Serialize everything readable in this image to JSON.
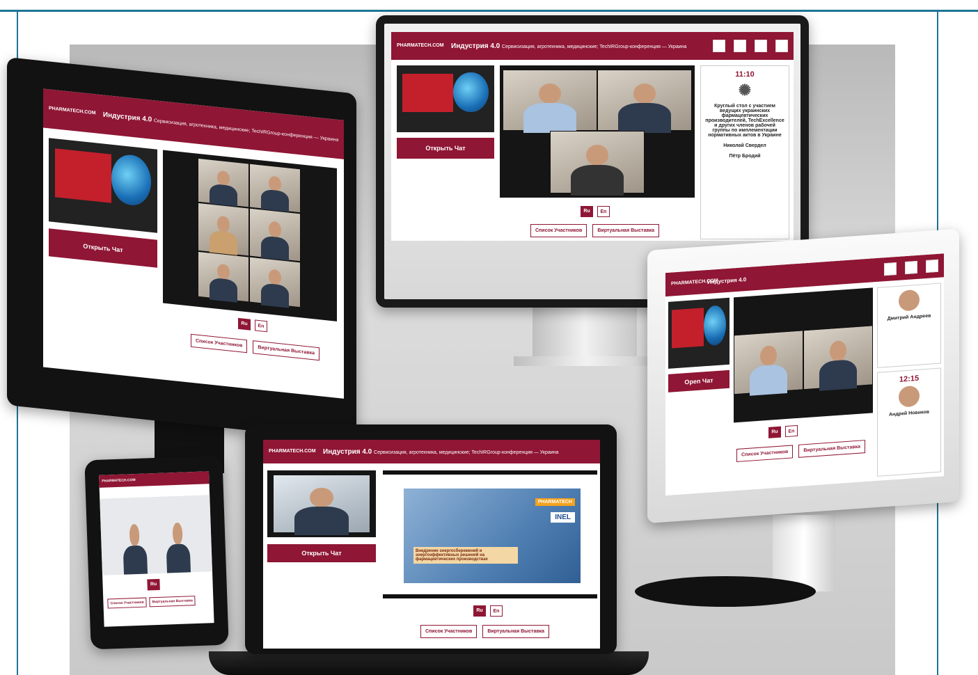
{
  "image": {
    "width": 1405,
    "height": 970,
    "description_title": "Event platform shown on multiple devices"
  },
  "event": {
    "header_title": "Индустрия 4.0",
    "header_subtitle": "Сервисизация, агротехника, медицинские; TechIRGroup-конференция — Украина",
    "chat_button": "Открыть Чат",
    "chat_button_short": "Open Чат",
    "lang_ru": "Ru",
    "lang_en": "En",
    "participants_button": "Список Участников",
    "exhibition_button": "Виртуальная Выставка",
    "logo_text": "PHARMATECH.COM"
  },
  "monitor_side": {
    "time": "11:10",
    "text": "Круглый стол с участием ведущих украинских фармацевтических производителей, TechExcellence и других членов рабочей группы по имплементации нормативных актов в Украине",
    "name": "Николай Свердел",
    "name2": "Пётр Бродий"
  },
  "monitor_right_side": {
    "name": "Дмитрий Андреев",
    "time": "12:15",
    "name2": "Андрей Новиков"
  },
  "laptop_slide": {
    "brand": "PHARMATECH",
    "partner": "INEL",
    "caption": "Внедрение энергосбережений и энергоэффективных решений на фармацевтических производствах"
  },
  "colors": {
    "brand": "#8f1634",
    "accent": "#1e7596"
  }
}
